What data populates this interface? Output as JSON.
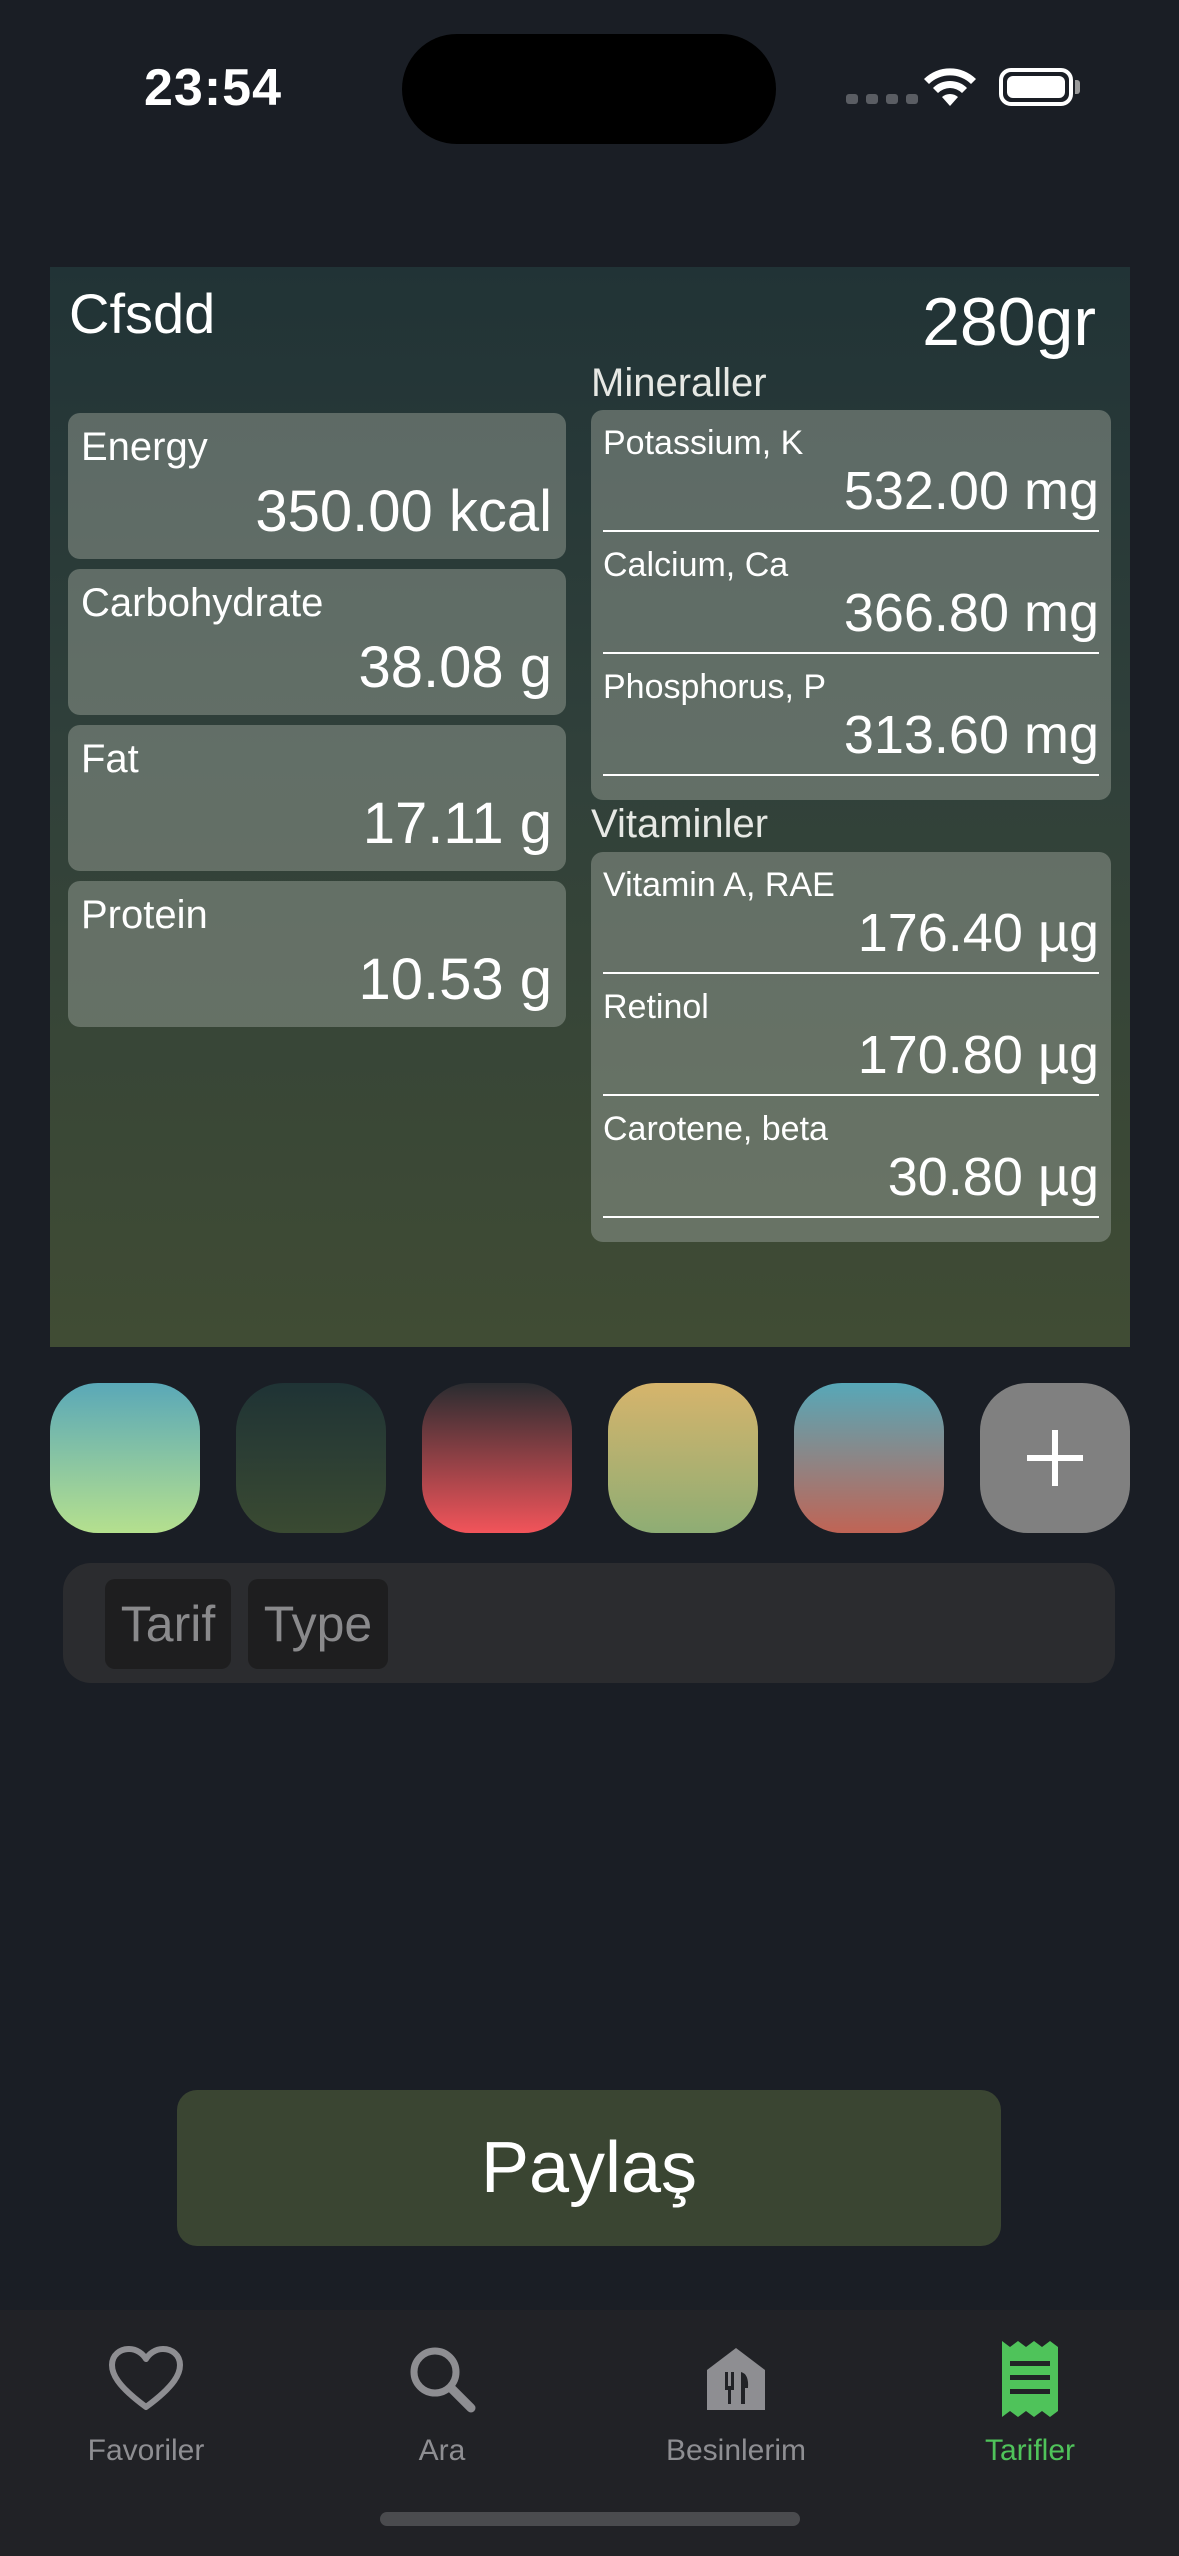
{
  "status_bar": {
    "time": "23:54"
  },
  "card": {
    "title": "Cfsdd",
    "weight": "280gr",
    "macros": [
      {
        "label": "Energy",
        "value": "350.00 kcal"
      },
      {
        "label": "Carbohydrate",
        "value": "38.08 g"
      },
      {
        "label": "Fat",
        "value": "17.11 g"
      },
      {
        "label": "Protein",
        "value": "10.53 g"
      }
    ],
    "minerals": {
      "title": "Mineraller",
      "items": [
        {
          "label": "Potassium, K",
          "value": "532.00 mg"
        },
        {
          "label": "Calcium, Ca",
          "value": "366.80 mg"
        },
        {
          "label": "Phosphorus, P",
          "value": "313.60 mg"
        }
      ]
    },
    "vitamins": {
      "title": "Vitaminler",
      "items": [
        {
          "label": "Vitamin A, RAE",
          "value": "176.40 µg"
        },
        {
          "label": "Retinol",
          "value": "170.80 µg"
        },
        {
          "label": "Carotene, beta",
          "value": "30.80 µg"
        }
      ]
    }
  },
  "swatches": [
    {
      "top": "#5aa8b8",
      "bottom": "#b5e08e"
    },
    {
      "top": "#1f3335",
      "bottom": "#3a4a32"
    },
    {
      "top": "#2a2c30",
      "bottom": "#f2545a"
    },
    {
      "top": "#d6b46c",
      "bottom": "#8ead74"
    },
    {
      "top": "#57a8b8",
      "bottom": "#c06455"
    }
  ],
  "add_swatch_icon": "plus-icon",
  "tags": [
    "Tarif",
    "Type"
  ],
  "share_button": "Paylaş",
  "tab_bar": {
    "active_color": "#4fc35a",
    "tabs": [
      {
        "label": "Favoriler",
        "icon": "heart-icon"
      },
      {
        "label": "Ara",
        "icon": "search-icon"
      },
      {
        "label": "Besinlerim",
        "icon": "food-house-icon"
      },
      {
        "label": "Tarifler",
        "icon": "receipt-icon"
      }
    ]
  }
}
